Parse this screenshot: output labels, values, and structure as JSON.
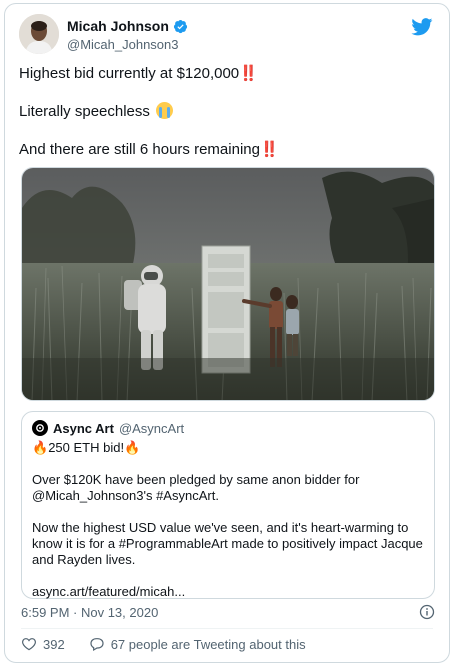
{
  "author": {
    "name": "Micah Johnson",
    "handle": "@Micah_Johnson3",
    "verified": true
  },
  "tweet": {
    "line1_text": "Highest bid currently at $120,000",
    "line1_emoji": "‼️",
    "line2_text": "Literally speechless",
    "line2_emoji": "loudly-crying-face",
    "line3_text": "And there are still 6 hours remaining",
    "line3_emoji": "‼️"
  },
  "media": {
    "image_alt": "Astronaut and two children beside a white door in a tall grass field"
  },
  "quoted_tweet": {
    "name": "Async Art",
    "handle": "@AsyncArt",
    "headline_emoji": "🔥",
    "headline": "250 ETH bid!",
    "para1": "Over $120K have been pledged by same anon bidder for @Micah_Johnson3's #AsyncArt.",
    "para2": "Now the highest USD value we've seen, and it's heart-warming to know it is for a #ProgrammableArt made to positively impact Jacque and Rayden lives.",
    "link": "async.art/featured/micah..."
  },
  "meta": {
    "timestamp": "6:59 PM · Nov 13, 2020"
  },
  "actions": {
    "likes": "392",
    "tweeting_about": "67 people are Tweeting about this"
  },
  "colors": {
    "twitter_blue": "#1d9bf0",
    "secondary_text": "#536471",
    "border": "#cfd9de",
    "bang": "#e0245e"
  }
}
